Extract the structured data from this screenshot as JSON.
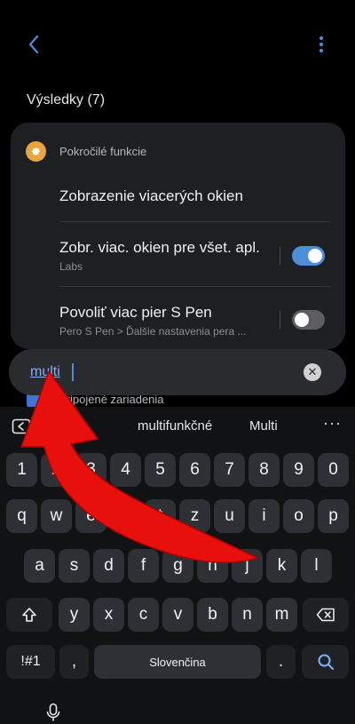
{
  "header": {
    "back_icon": "chevron-left-icon",
    "more_icon": "more-vertical-icon"
  },
  "results": {
    "title": "Výsledky (7)"
  },
  "category": {
    "label": "Pokročilé funkcie",
    "icon": "gear-icon",
    "icon_color": "#e8a53b"
  },
  "items": [
    {
      "title": "Zobrazenie viacerých okien",
      "subtitle": ""
    },
    {
      "title": "Zobr. viac. okien pre všet. apl.",
      "subtitle": "Labs",
      "toggle": true
    },
    {
      "title": "Povoliť viac pier S Pen",
      "subtitle": "Pero S Pen > Ďalšie nastavenia pera ...",
      "toggle": false
    }
  ],
  "peek": {
    "label": "Pripojené zariadenia"
  },
  "search": {
    "value": "multi",
    "clear_icon": "close-icon"
  },
  "keyboard": {
    "suggestions": [
      "multi",
      "multifunkčné",
      "Multi"
    ],
    "number_row": [
      "1",
      "2",
      "3",
      "4",
      "5",
      "6",
      "7",
      "8",
      "9",
      "0"
    ],
    "row1": [
      "q",
      "w",
      "e",
      "r",
      "t",
      "z",
      "u",
      "i",
      "o",
      "p"
    ],
    "row2": [
      "a",
      "s",
      "d",
      "f",
      "g",
      "h",
      "j",
      "k",
      "l"
    ],
    "row3": [
      "y",
      "x",
      "c",
      "v",
      "b",
      "n",
      "m"
    ],
    "symbols_label": "!#1",
    "comma_label": ",",
    "space_label": "Slovenčina",
    "period_label": "."
  },
  "colors": {
    "accent": "#4d8fdb",
    "annotation_arrow": "#e8100c"
  }
}
